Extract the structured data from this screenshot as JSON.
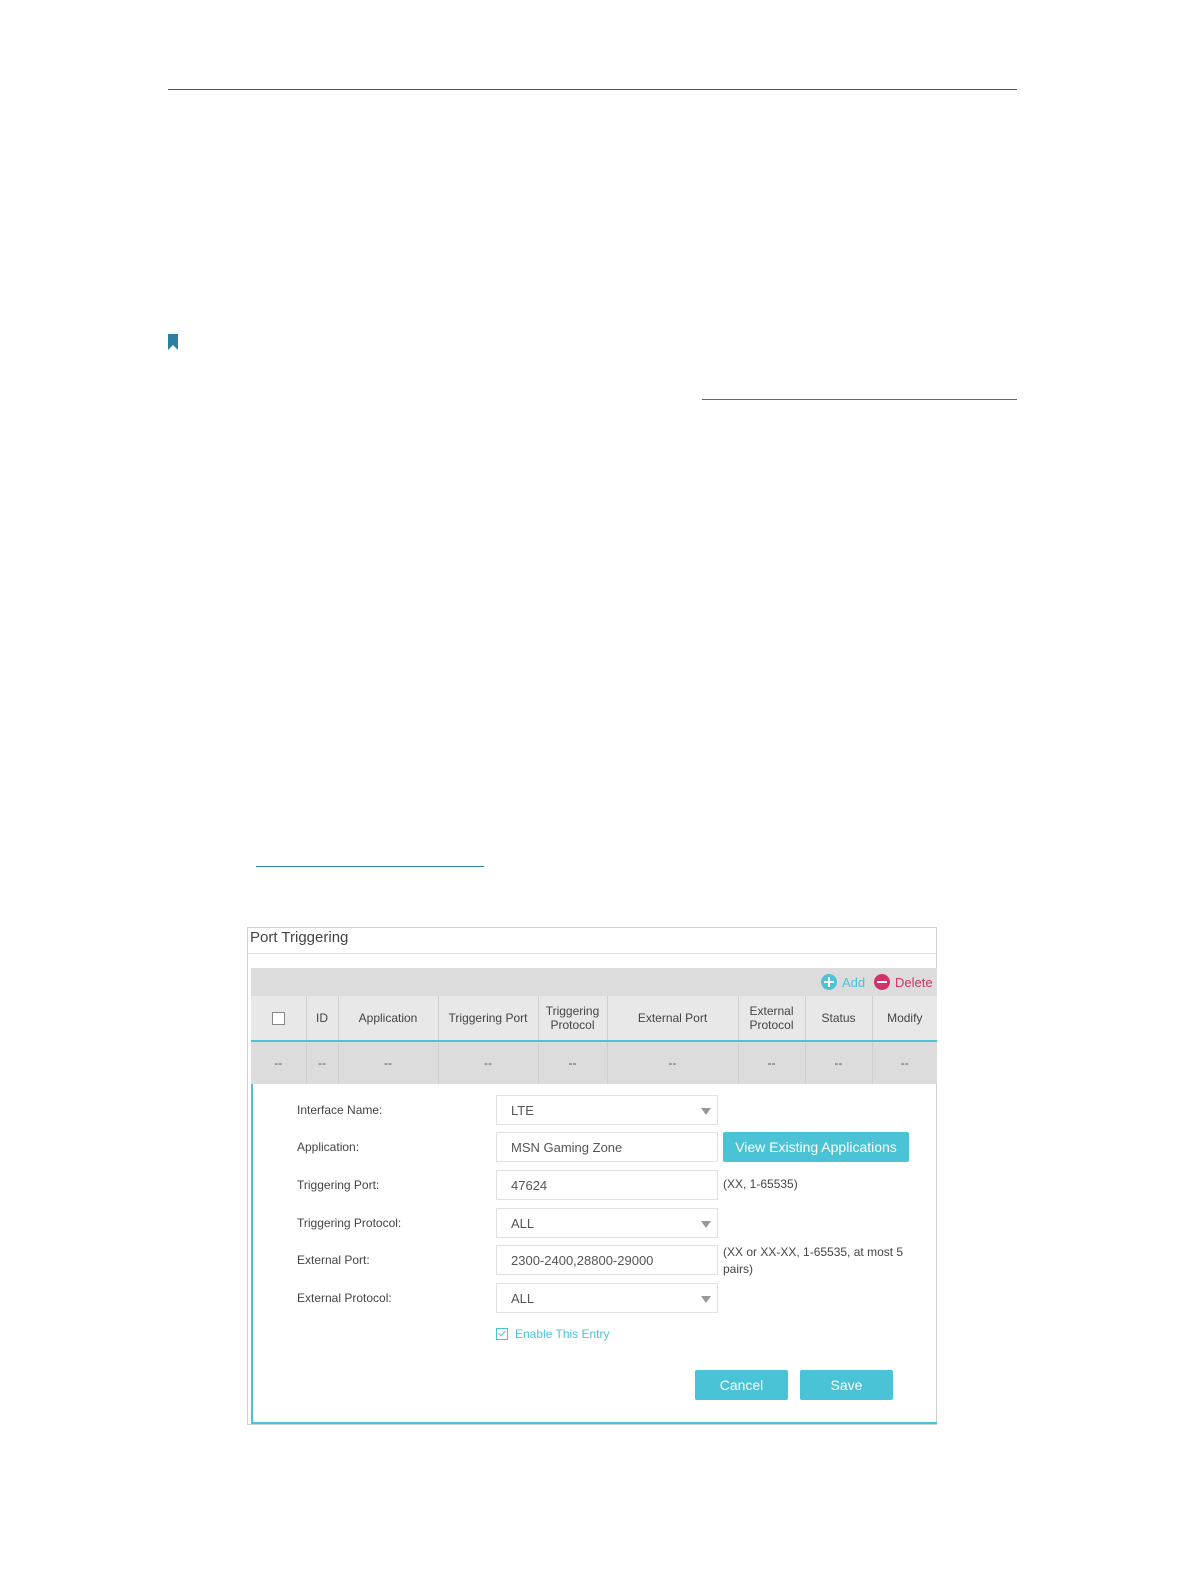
{
  "panel": {
    "title": "Port Triggering"
  },
  "toolbar": {
    "add_label": "Add",
    "delete_label": "Delete"
  },
  "table": {
    "headers": [
      "ID",
      "Application",
      "Triggering Port",
      "Triggering Protocol",
      "External Port",
      "External Protocol",
      "Status",
      "Modify"
    ],
    "row": [
      "--",
      "--",
      "--",
      "--",
      "--",
      "--",
      "--",
      "--",
      "--"
    ]
  },
  "form": {
    "interface_name": {
      "label": "Interface Name:",
      "value": "LTE"
    },
    "application": {
      "label": "Application:",
      "value": "MSN Gaming Zone",
      "button": "View Existing Applications"
    },
    "triggering_port": {
      "label": "Triggering Port:",
      "value": "47624",
      "hint": "(XX, 1-65535)"
    },
    "triggering_protocol": {
      "label": "Triggering Protocol:",
      "value": "ALL"
    },
    "external_port": {
      "label": "External Port:",
      "value": "2300-2400,28800-29000",
      "hint": "(XX or XX-XX, 1-65535, at most 5 pairs)"
    },
    "external_protocol": {
      "label": "External Protocol:",
      "value": "ALL"
    },
    "enable_entry": {
      "label": "Enable This Entry",
      "checked": true
    },
    "cancel_label": "Cancel",
    "save_label": "Save"
  },
  "colors": {
    "accent": "#4ac3d6",
    "delete": "#d0336b",
    "link_rule": "#2c7fa0"
  }
}
